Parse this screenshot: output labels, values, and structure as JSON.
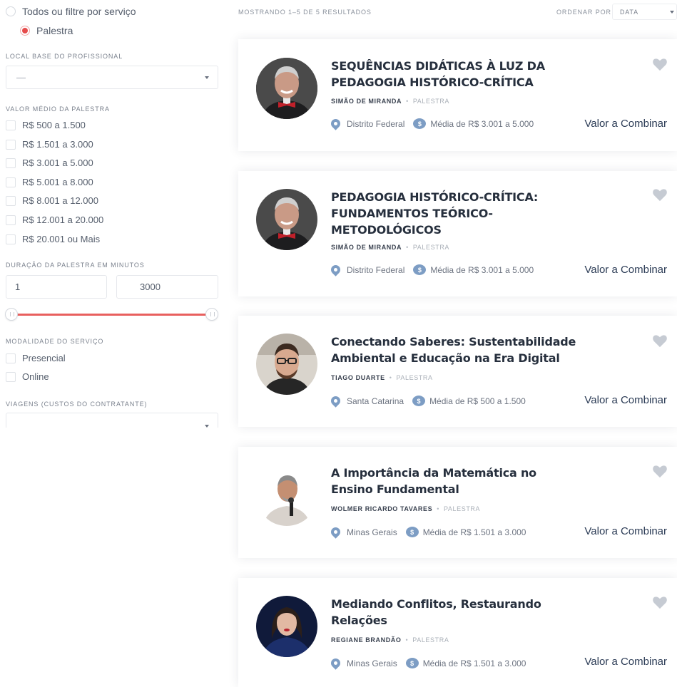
{
  "filters": {
    "service_all": "Todos ou filtre por serviço",
    "service_selected": "Palestra",
    "local_label": "LOCAL BASE DO PROFISSIONAL",
    "local_value": "—",
    "valor_label": "VALOR MÉDIO DA PALESTRA",
    "valor_options": [
      "R$ 500 a 1.500",
      "R$ 1.501 a 3.000",
      "R$ 3.001 a 5.000",
      "R$ 5.001 a 8.000",
      "R$ 8.001 a 12.000",
      "R$ 12.001 a 20.000",
      "R$ 20.001 ou Mais"
    ],
    "duracao_label": "DURAÇÃO DA PALESTRA EM MINUTOS",
    "duracao_min": "1",
    "duracao_max": "3000",
    "modalidade_label": "MODALIDADE DO SERVIÇO",
    "modalidade_options": [
      "Presencial",
      "Online"
    ],
    "viagens_label": "VIAGENS (CUSTOS DO CONTRATANTE)",
    "accent_color": "#e8605e"
  },
  "results": {
    "count_text": "MOSTRANDO 1–5 DE 5 RESULTADOS",
    "sort_label": "ORDENAR POR",
    "sort_value": "DATA"
  },
  "cards": [
    {
      "title": "SEQUÊNCIAS DIDÁTICAS À LUZ DA PEDAGOGIA HISTÓRICO-CRÍTICA",
      "author": "SIMÃO DE MIRANDA",
      "type": "PALESTRA",
      "location": "Distrito Federal",
      "price_range": "Média de R$ 3.001 a 5.000",
      "price": "Valor a Combinar"
    },
    {
      "title": "PEDAGOGIA HISTÓRICO-CRÍTICA: FUNDAMENTOS TEÓRICO-METODOLÓGICOS",
      "author": "SIMÃO DE MIRANDA",
      "type": "PALESTRA",
      "location": "Distrito Federal",
      "price_range": "Média de R$ 3.001 a 5.000",
      "price": "Valor a Combinar"
    },
    {
      "title": "Conectando Saberes: Sustentabilidade Ambiental e Educação na Era Digital",
      "author": "TIAGO DUARTE",
      "type": "PALESTRA",
      "location": "Santa Catarina",
      "price_range": "Média de R$ 500 a 1.500",
      "price": "Valor a Combinar"
    },
    {
      "title": "A Importância da Matemática no Ensino Fundamental",
      "author": "WOLMER RICARDO TAVARES",
      "type": "PALESTRA",
      "location": "Minas Gerais",
      "price_range": "Média de R$ 1.501 a 3.000",
      "price": "Valor a Combinar"
    },
    {
      "title": "Mediando Conflitos, Restaurando Relações",
      "author": "REGIANE BRANDÃO",
      "type": "PALESTRA",
      "location": "Minas Gerais",
      "price_range": "Média de R$ 1.501 a 3.000",
      "price": "Valor a Combinar"
    }
  ],
  "icons": {
    "location": "map-pin-icon",
    "money": "coin-icon",
    "favorite": "heart-icon"
  }
}
